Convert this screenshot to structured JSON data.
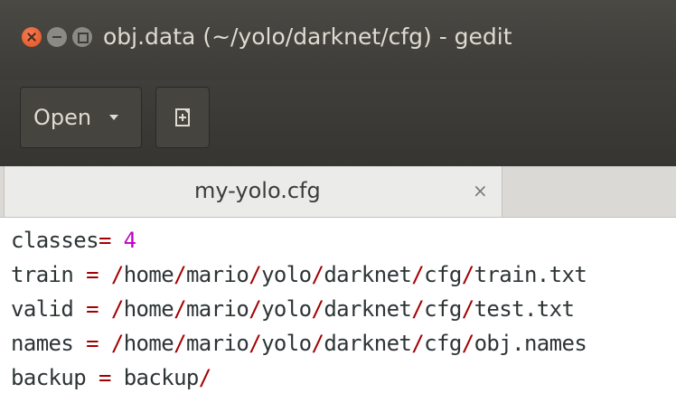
{
  "window": {
    "title": "obj.data (~/yolo/darknet/cfg) - gedit"
  },
  "toolbar": {
    "open_label": "Open",
    "new_icon": "new-document-icon"
  },
  "tabs": [
    {
      "label": "my-yolo.cfg",
      "close": "×"
    }
  ],
  "editor": {
    "lines": [
      {
        "key": "classes",
        "eq": "=",
        "value": "4"
      },
      {
        "key": "train",
        "eq": "=",
        "path": [
          "/",
          "home",
          "/",
          "mario",
          "/",
          "yolo",
          "/",
          "darknet",
          "/",
          "cfg",
          "/",
          "train.txt"
        ]
      },
      {
        "key": "valid",
        "eq": "=",
        "path": [
          "/",
          "home",
          "/",
          "mario",
          "/",
          "yolo",
          "/",
          "darknet",
          "/",
          "cfg",
          "/",
          "test.txt"
        ]
      },
      {
        "key": "names",
        "eq": "=",
        "path": [
          "/",
          "home",
          "/",
          "mario",
          "/",
          "yolo",
          "/",
          "darknet",
          "/",
          "cfg",
          "/",
          "obj.names"
        ]
      },
      {
        "key": "backup",
        "eq": "=",
        "path": [
          "backup",
          "/"
        ]
      }
    ]
  },
  "colors": {
    "titlebar": "#3d3c38",
    "close_button": "#e0521f",
    "number": "#c000c0",
    "separator": "#a40000"
  }
}
